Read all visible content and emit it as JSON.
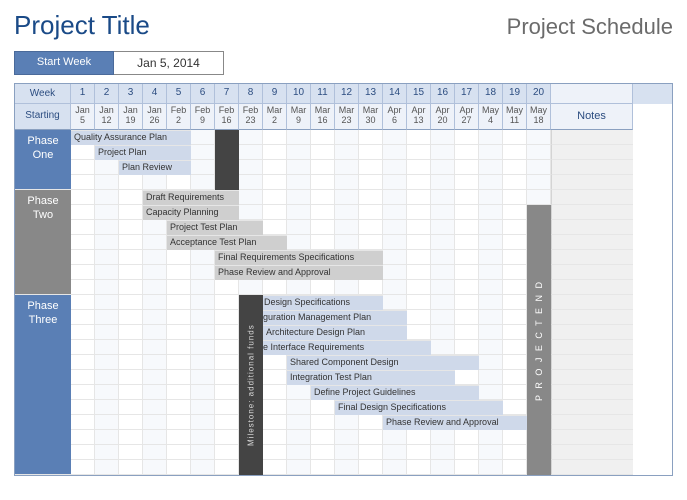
{
  "title": "Project Title",
  "subtitle": "Project Schedule",
  "start_week_label": "Start Week",
  "start_week_value": "Jan 5, 2014",
  "week_label": "Week",
  "starting_label": "Starting",
  "notes_label": "Notes",
  "weeks": [
    1,
    2,
    3,
    4,
    5,
    6,
    7,
    8,
    9,
    10,
    11,
    12,
    13,
    14,
    15,
    16,
    17,
    18,
    19,
    20
  ],
  "dates": [
    {
      "m": "Jan",
      "d": 5
    },
    {
      "m": "Jan",
      "d": 12
    },
    {
      "m": "Jan",
      "d": 19
    },
    {
      "m": "Jan",
      "d": 26
    },
    {
      "m": "Feb",
      "d": 2
    },
    {
      "m": "Feb",
      "d": 9
    },
    {
      "m": "Feb",
      "d": 16
    },
    {
      "m": "Feb",
      "d": 23
    },
    {
      "m": "Mar",
      "d": 2
    },
    {
      "m": "Mar",
      "d": 9
    },
    {
      "m": "Mar",
      "d": 16
    },
    {
      "m": "Mar",
      "d": 23
    },
    {
      "m": "Mar",
      "d": 30
    },
    {
      "m": "Apr",
      "d": 6
    },
    {
      "m": "Apr",
      "d": 13
    },
    {
      "m": "Apr",
      "d": 20
    },
    {
      "m": "Apr",
      "d": 27
    },
    {
      "m": "May",
      "d": 4
    },
    {
      "m": "May",
      "d": 11
    },
    {
      "m": "May",
      "d": 18
    }
  ],
  "phases": [
    {
      "name": "Phase One",
      "color": "blue",
      "start_row": 0,
      "rows": 4
    },
    {
      "name": "Phase Two",
      "color": "gray",
      "start_row": 4,
      "rows": 7
    },
    {
      "name": "Phase Three",
      "color": "blue",
      "start_row": 11,
      "rows": 12
    }
  ],
  "total_rows": 23,
  "milestone1": {
    "label": "",
    "col": 7,
    "row": 0,
    "rows": 4
  },
  "milestone2": {
    "label": "Milestone: additional funds",
    "col": 8,
    "row": 11,
    "rows": 12
  },
  "project_end": {
    "label": "P R O J E C T   E N D",
    "col": 20,
    "row": 5,
    "rows": 18
  },
  "chart_data": {
    "type": "gantt",
    "title": "Project Schedule",
    "x_unit": "week",
    "x_range": [
      1,
      20
    ],
    "tasks": [
      {
        "phase": "Phase One",
        "row": 0,
        "name": "Quality Assurance Plan",
        "start": 1,
        "span": 5,
        "color": "blue"
      },
      {
        "phase": "Phase One",
        "row": 1,
        "name": "Project Plan",
        "start": 2,
        "span": 4,
        "color": "blue"
      },
      {
        "phase": "Phase One",
        "row": 2,
        "name": "Plan Review",
        "start": 3,
        "span": 3,
        "color": "blue"
      },
      {
        "phase": "Phase Two",
        "row": 4,
        "name": "Draft Requirements",
        "start": 4,
        "span": 4,
        "color": "gray"
      },
      {
        "phase": "Phase Two",
        "row": 5,
        "name": "Capacity Planning",
        "start": 4,
        "span": 4,
        "color": "gray"
      },
      {
        "phase": "Phase Two",
        "row": 6,
        "name": "Project Test Plan",
        "start": 5,
        "span": 4,
        "color": "gray"
      },
      {
        "phase": "Phase Two",
        "row": 7,
        "name": "Acceptance Test Plan",
        "start": 5,
        "span": 5,
        "color": "gray"
      },
      {
        "phase": "Phase Two",
        "row": 8,
        "name": "Final Requirements Specifications",
        "start": 7,
        "span": 7,
        "color": "gray"
      },
      {
        "phase": "Phase Two",
        "row": 9,
        "name": "Phase Review and Approval",
        "start": 7,
        "span": 7,
        "color": "gray"
      },
      {
        "phase": "Phase Three",
        "row": 11,
        "name": "Draft Design Specifications",
        "start": 8,
        "span": 6,
        "color": "blue"
      },
      {
        "phase": "Phase Three",
        "row": 12,
        "name": "Configuration Management Plan",
        "start": 8,
        "span": 7,
        "color": "blue"
      },
      {
        "phase": "Phase Three",
        "row": 13,
        "name": "Architecture Design Plan",
        "start": 9,
        "span": 6,
        "color": "blue"
      },
      {
        "phase": "Phase Three",
        "row": 14,
        "name": "Define Interface Requirements",
        "start": 8,
        "span": 8,
        "color": "blue"
      },
      {
        "phase": "Phase Three",
        "row": 15,
        "name": "Shared Component Design",
        "start": 10,
        "span": 8,
        "color": "blue"
      },
      {
        "phase": "Phase Three",
        "row": 16,
        "name": "Integration Test Plan",
        "start": 10,
        "span": 7,
        "color": "blue"
      },
      {
        "phase": "Phase Three",
        "row": 17,
        "name": "Define Project Guidelines",
        "start": 11,
        "span": 7,
        "color": "blue"
      },
      {
        "phase": "Phase Three",
        "row": 18,
        "name": "Final Design Specifications",
        "start": 12,
        "span": 7,
        "color": "blue"
      },
      {
        "phase": "Phase Three",
        "row": 19,
        "name": "Phase Review and Approval",
        "start": 14,
        "span": 7,
        "color": "blue"
      }
    ],
    "milestones": [
      {
        "name": "",
        "week": 7,
        "rows": [
          0,
          4
        ]
      },
      {
        "name": "Milestone: additional funds",
        "week": 8,
        "rows": [
          11,
          23
        ]
      },
      {
        "name": "PROJECT END",
        "week": 20,
        "rows": [
          5,
          23
        ]
      }
    ]
  }
}
